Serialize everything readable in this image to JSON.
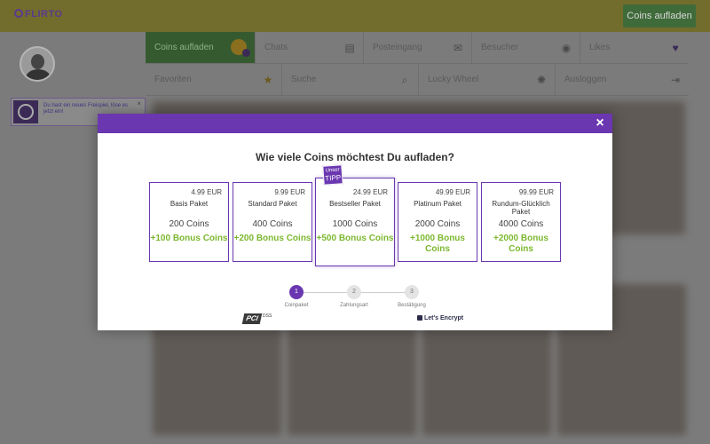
{
  "brand": {
    "name": "FLIRTO"
  },
  "header": {
    "cta_label": "Coins aufladen"
  },
  "notice": {
    "text": "Du hast ein neues Freispiel, löse es jetzt ein!",
    "close": "×"
  },
  "nav": {
    "items": [
      {
        "label": "Coins aufladen",
        "icon": "coin-icon"
      },
      {
        "label": "Chats",
        "icon": "chat-icon"
      },
      {
        "label": "Posteingang",
        "icon": "mail-icon"
      },
      {
        "label": "Besucher",
        "icon": "eye-icon"
      },
      {
        "label": "Likes",
        "icon": "heart-icon"
      },
      {
        "label": "Favoriten",
        "icon": "star-icon"
      },
      {
        "label": "Suche",
        "icon": "search-icon"
      },
      {
        "label": "Lucky Wheel",
        "icon": "wheel-icon"
      },
      {
        "label": "Ausloggen",
        "icon": "logout-icon"
      }
    ]
  },
  "modal": {
    "title": "Wie viele Coins möchtest Du aufladen?",
    "close": "×",
    "packages": [
      {
        "price": "4.99 EUR",
        "name": "Basis Paket",
        "coins": "200 Coins",
        "bonus": "+100 Bonus Coins"
      },
      {
        "price": "9.99 EUR",
        "name": "Standard Paket",
        "coins": "400 Coins",
        "bonus": "+200 Bonus Coins"
      },
      {
        "price": "24.99 EUR",
        "name": "Bestseller Paket",
        "coins": "1000 Coins",
        "bonus": "+500 Bonus Coins",
        "badge_small": "Unser",
        "badge_big": "TIPP"
      },
      {
        "price": "49.99 EUR",
        "name": "Platinum Paket",
        "coins": "2000 Coins",
        "bonus": "+1000 Bonus Coins"
      },
      {
        "price": "99.99 EUR",
        "name": "Rundum-Glücklich Paket",
        "coins": "4000 Coins",
        "bonus": "+2000 Bonus Coins"
      }
    ],
    "steps": [
      {
        "number": "1",
        "label": "Coinpaket"
      },
      {
        "number": "2",
        "label": "Zahlungsart"
      },
      {
        "number": "3",
        "label": "Bestätigung"
      }
    ],
    "trust": {
      "pci": "PCI",
      "pci_dss": "DSS",
      "lets_encrypt": "Let's Encrypt"
    }
  },
  "colors": {
    "purple": "#6a37b0",
    "green": "#7cb82f",
    "header_yellow": "#ece55c"
  }
}
